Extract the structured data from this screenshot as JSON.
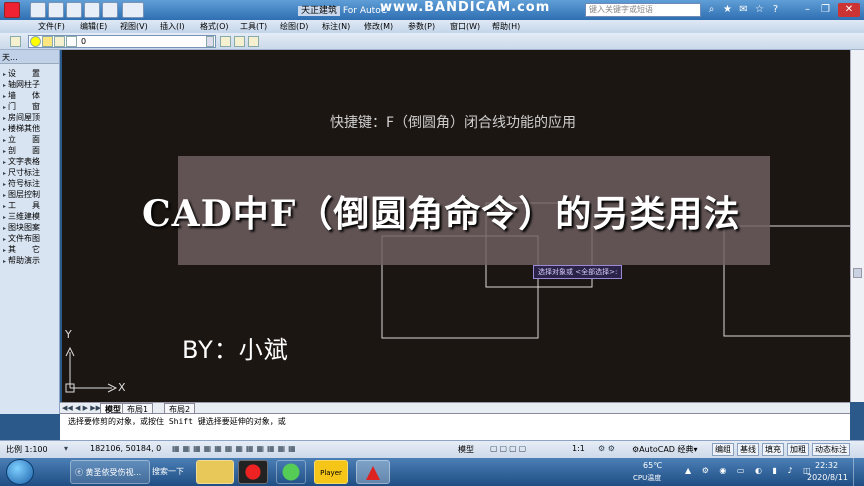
{
  "window": {
    "title_prefix": "天正建筑",
    "title_suffix": "For AutoC",
    "watermark_pre": "www.",
    "watermark_brand": "BANDICAM",
    "watermark_dotcom": ".com",
    "help_search_placeholder": "键入关键字或短语"
  },
  "menu": [
    "文件(F)",
    "编辑(E)",
    "视图(V)",
    "插入(I)",
    "格式(O)",
    "工具(T)",
    "绘图(D)",
    "标注(N)",
    "修改(M)",
    "参数(P)",
    "窗口(W)",
    "帮助(H)"
  ],
  "layer": {
    "current": "0"
  },
  "left_panel": {
    "header": "天...",
    "items": [
      "设　　置",
      "轴网柱子",
      "墙　　体",
      "门　　窗",
      "房间屋顶",
      "楼梯其他",
      "立　　面",
      "剖　　面",
      "文字表格",
      "尺寸标注",
      "符号标注",
      "图层控制",
      "工　　具",
      "三维建模",
      "图块图案",
      "文件布图",
      "其　　它",
      "帮助演示"
    ]
  },
  "canvas": {
    "subtitle": "快捷键：F（倒圆角）闭合线功能的应用",
    "headline": "CAD中F（倒圆角命令）的另类用法",
    "author": "BY：小斌",
    "tooltip": "选择对象或 <全部选择>:",
    "ucs_x": "X",
    "ucs_y": "Y"
  },
  "tabs": [
    "模型",
    "布局1",
    "布局2"
  ],
  "command": {
    "line": "选择要修剪的对象，或按住 Shift 键选择要延伸的对象，或"
  },
  "status": {
    "scale": "比例 1:100",
    "coords": "182106, 50184, 0",
    "model": "模型",
    "ratio": "1:1",
    "workspace": "AutoCAD 经典",
    "buttons": [
      "编组",
      "基线",
      "填充",
      "加粗",
      "动态标注"
    ]
  },
  "taskbar": {
    "tasks": [
      "黄圣依受伤视...",
      "搜索一下"
    ],
    "player_label": "Player",
    "temp": "65℃",
    "temp_label": "CPU温度",
    "time": "22:32",
    "date": "2020/8/11"
  },
  "colors": {
    "accent": "#2f6fb2",
    "canvas": "#1c1612",
    "overlay": "#706062"
  }
}
